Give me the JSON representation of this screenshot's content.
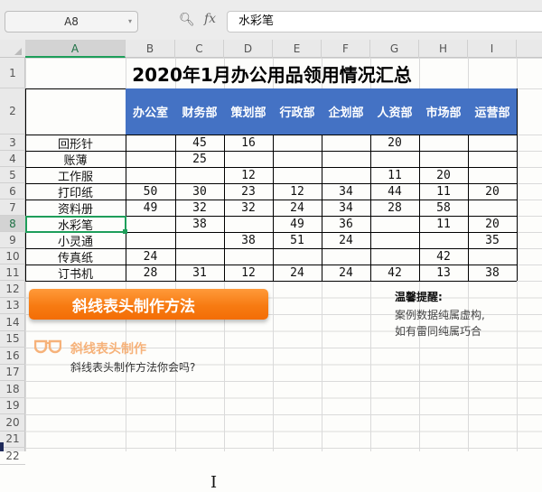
{
  "toolbar": {
    "cell_ref": "A8",
    "fx_label": "fx",
    "formula_value": "水彩笔"
  },
  "columns": [
    "A",
    "B",
    "C",
    "D",
    "E",
    "F",
    "G",
    "H",
    "I"
  ],
  "rows": [
    "1",
    "2",
    "3",
    "4",
    "5",
    "6",
    "7",
    "8",
    "9",
    "10",
    "11",
    "12",
    "13",
    "14",
    "15",
    "16",
    "17",
    "18",
    "19",
    "20",
    "21",
    "22"
  ],
  "sheet": {
    "title": "2020年1月办公用品领用情况汇总",
    "departments": [
      "办公室",
      "财务部",
      "策划部",
      "行政部",
      "企划部",
      "人资部",
      "市场部",
      "运营部"
    ],
    "items": [
      {
        "name": "回形针",
        "values": [
          "",
          "45",
          "16",
          "",
          "",
          "20",
          "",
          ""
        ]
      },
      {
        "name": "账薄",
        "values": [
          "",
          "25",
          "",
          "",
          "",
          "",
          "",
          ""
        ]
      },
      {
        "name": "工作服",
        "values": [
          "",
          "",
          "12",
          "",
          "",
          "11",
          "20",
          ""
        ]
      },
      {
        "name": "打印纸",
        "values": [
          "50",
          "30",
          "23",
          "12",
          "34",
          "44",
          "11",
          "20"
        ]
      },
      {
        "name": "资料册",
        "values": [
          "49",
          "32",
          "32",
          "24",
          "34",
          "28",
          "58",
          ""
        ]
      },
      {
        "name": "水彩笔",
        "values": [
          "",
          "38",
          "",
          "49",
          "36",
          "",
          "11",
          "20"
        ]
      },
      {
        "name": "小灵通",
        "values": [
          "",
          "",
          "38",
          "51",
          "24",
          "",
          "",
          "35"
        ]
      },
      {
        "name": "传真纸",
        "values": [
          "24",
          "",
          "",
          "",
          "",
          "",
          "42",
          ""
        ]
      },
      {
        "name": "订书机",
        "values": [
          "28",
          "31",
          "12",
          "24",
          "24",
          "42",
          "13",
          "38"
        ]
      }
    ]
  },
  "banner": {
    "label": "斜线表头制作方法"
  },
  "section": {
    "title": "斜线表头制作",
    "description": "斜线表头制作方法你会吗?"
  },
  "tip": {
    "title": "温馨提醒:",
    "line1": "案例数据纯属虚构,",
    "line2": "如有雷同纯属巧合"
  },
  "colors": {
    "header_blue": "#4472c4",
    "banner_orange": "#f77b12",
    "selection_green": "#1e9e5a"
  }
}
